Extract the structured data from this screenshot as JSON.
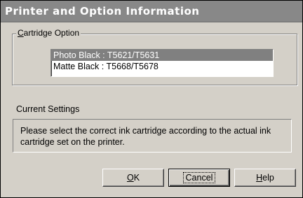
{
  "window": {
    "title": "Printer and Option Information"
  },
  "cartridge_option": {
    "legend_accel": "C",
    "legend_rest": "artridge Option",
    "items": [
      {
        "label": "Photo Black : T5621/T5631",
        "selected": true
      },
      {
        "label": "Matte Black : T5668/T5678",
        "selected": false
      }
    ]
  },
  "current_settings": {
    "label": "Current Settings",
    "message_line1": "Please select the correct ink cartridge according to the actual ink",
    "message_line2": "cartridge set on the printer."
  },
  "buttons": {
    "ok_accel": "O",
    "ok_rest": "K",
    "cancel_label": "Cancel",
    "help_accel": "H",
    "help_rest": "elp"
  }
}
